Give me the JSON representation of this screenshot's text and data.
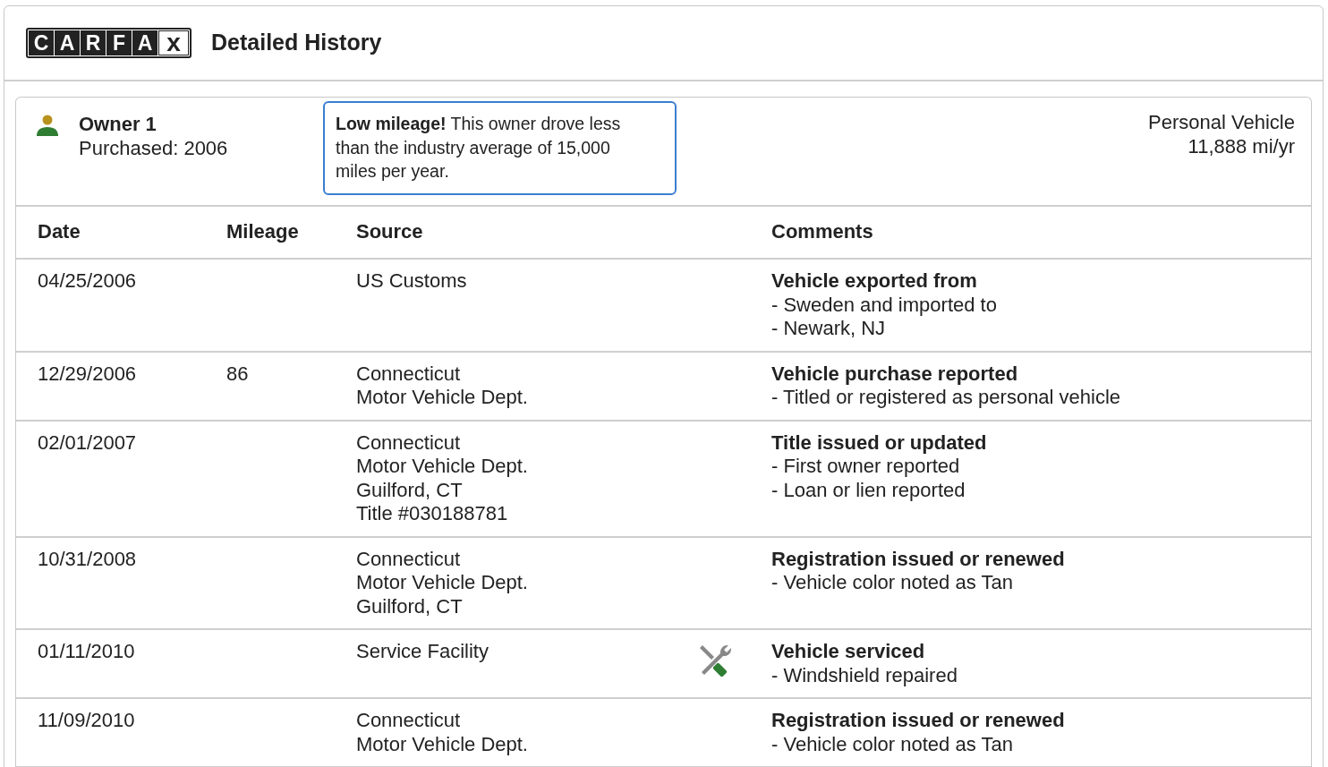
{
  "header": {
    "logo_letters": [
      "C",
      "A",
      "R",
      "F",
      "A",
      "x"
    ],
    "title": "Detailed History"
  },
  "owner": {
    "name": "Owner 1",
    "purchased": "Purchased: 2006",
    "alert": "**Low mileage!** This owner drove less than the industry average of 15,000 miles per year.",
    "usage": "Personal Vehicle",
    "mileage_per_year": "11,888 mi/yr"
  },
  "table": {
    "columns": [
      "Date",
      "Mileage",
      "Source",
      "Comments"
    ],
    "rows": [
      {
        "date": "04/25/2006",
        "mileage": "",
        "source": [
          "US Customs"
        ],
        "kind": "record",
        "comment_title": "Vehicle exported from",
        "comment_details": [
          "- Sweden and imported to",
          "- Newark, NJ"
        ]
      },
      {
        "date": "12/29/2006",
        "mileage": "86",
        "source": [
          "Connecticut",
          "Motor Vehicle Dept."
        ],
        "kind": "record",
        "comment_title": "Vehicle purchase reported",
        "comment_details": [
          "- Titled or registered as personal vehicle"
        ]
      },
      {
        "date": "02/01/2007",
        "mileage": "",
        "source": [
          "Connecticut",
          "Motor Vehicle Dept.",
          "Guilford, CT",
          "Title #030188781"
        ],
        "kind": "record",
        "comment_title": "Title issued or updated",
        "comment_details": [
          "- First owner reported",
          "- Loan or lien reported"
        ]
      },
      {
        "date": "10/31/2008",
        "mileage": "",
        "source": [
          "Connecticut",
          "Motor Vehicle Dept.",
          "Guilford, CT"
        ],
        "kind": "record",
        "comment_title": "Registration issued or renewed",
        "comment_details": [
          "- Vehicle color noted as Tan"
        ]
      },
      {
        "date": "01/11/2010",
        "mileage": "",
        "source": [
          "Service Facility"
        ],
        "kind": "service",
        "comment_title": "Vehicle serviced",
        "comment_details": [
          "- Windshield repaired"
        ]
      },
      {
        "date": "11/09/2010",
        "mileage": "",
        "source": [
          "Connecticut",
          "Motor Vehicle Dept."
        ],
        "kind": "record",
        "comment_title": "Registration issued or renewed",
        "comment_details": [
          "- Vehicle color noted as Tan"
        ]
      }
    ]
  }
}
